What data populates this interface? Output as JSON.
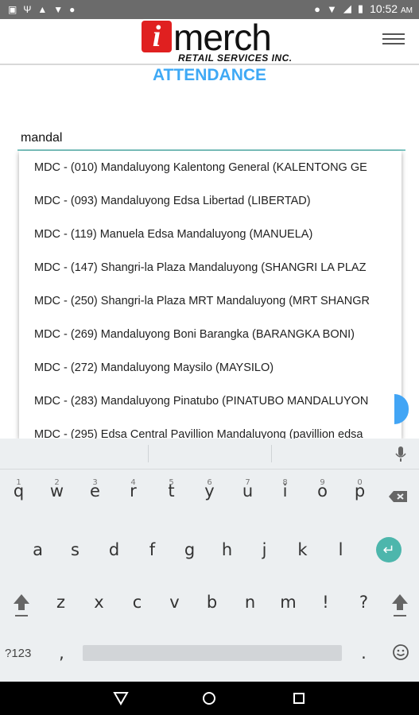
{
  "status": {
    "time": "10:52",
    "ampm": "AM",
    "left_icons": [
      "sim-icon",
      "usb-icon",
      "shield-icon",
      "download-icon",
      "android-icon"
    ]
  },
  "header": {
    "logo_i": "i",
    "logo_main": "merch",
    "logo_sub": "RETAIL SERVICES INC."
  },
  "title": "ATTENDANCE",
  "search": {
    "value": "mandal"
  },
  "dropdown": [
    "MDC - (010) Mandaluyong Kalentong General (KALENTONG GE",
    "MDC - (093) Mandaluyong Edsa Libertad (LIBERTAD)",
    "MDC - (119) Manuela Edsa Mandaluyong (MANUELA)",
    "MDC - (147) Shangri-la Plaza Mandaluyong (SHANGRI LA PLAZ",
    "MDC - (250) Shangri-la Plaza MRT Mandaluyong (MRT SHANGR",
    "MDC - (269) Mandaluyong Boni Barangka (BARANGKA BONI)",
    "MDC - (272) Mandaluyong Maysilo (MAYSILO)",
    "MDC - (283) Mandaluyong Pinatubo (PINATUBO MANDALUYON",
    "MDC - (295) Edsa Central Pavillion Mandaluyong (pavillion edsa"
  ],
  "keyboard": {
    "row1_nums": [
      "1",
      "2",
      "3",
      "4",
      "5",
      "6",
      "7",
      "8",
      "9",
      "0"
    ],
    "row1": [
      "q",
      "w",
      "e",
      "r",
      "t",
      "y",
      "u",
      "i",
      "o",
      "p"
    ],
    "row2": [
      "a",
      "s",
      "d",
      "f",
      "g",
      "h",
      "j",
      "k",
      "l"
    ],
    "row3": [
      "z",
      "x",
      "c",
      "v",
      "b",
      "n",
      "m",
      "!",
      "?"
    ],
    "symbols_label": "?123",
    "comma": ",",
    "period": "."
  }
}
